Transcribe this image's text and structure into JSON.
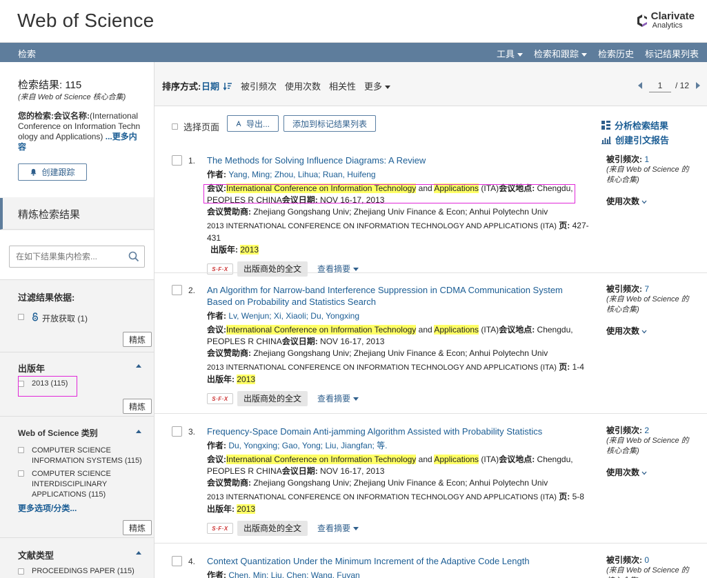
{
  "header": {
    "title": "Web of Science",
    "brand_name": "Clarivate",
    "brand_sub": "Analytics"
  },
  "nav": {
    "left": "检索",
    "items": [
      "工具",
      "检索和跟踪",
      "检索历史",
      "标记结果列表"
    ]
  },
  "sidebar": {
    "results_title": "检索结果: 115",
    "results_sub": "(来自 Web of Science 核心合集)",
    "query_label": "您的检索:",
    "query_field": "会议名称:",
    "query_value": "(International Conference on Information Technology and Applications)",
    "query_more": "...更多内容",
    "alert_button": "创建跟踪",
    "refine_title": "精炼检索结果",
    "search_placeholder": "在如下结果集内检索...",
    "filter_by": "过滤结果依据:",
    "open_access": "开放获取 (1)",
    "refine_btn": "精炼",
    "year_title": "出版年",
    "year_item": "2013 (115)",
    "category_title": "Web of Science 类别",
    "cat1": "COMPUTER SCIENCE INFORMATION SYSTEMS (115)",
    "cat2": "COMPUTER SCIENCE INTERDISCIPLINARY APPLICATIONS (115)",
    "more_options": "更多选项/分类...",
    "doctype_title": "文献类型",
    "doctype_item": "PROCEEDINGS PAPER (115)"
  },
  "sortbar": {
    "label": "排序方式:",
    "options": [
      "日期",
      "被引频次",
      "使用次数",
      "相关性",
      "更多"
    ]
  },
  "pager": {
    "current": "1",
    "total": "/ 12"
  },
  "actions": {
    "select_page": "选择页面",
    "export": "导出...",
    "add_marked": "添加到标记结果列表",
    "analyze": "分析检索结果",
    "citation_report": "创建引文报告"
  },
  "labels": {
    "author": "作者:",
    "conference": "会议:",
    "conf_and": "and",
    "conf_ita": "(ITA)",
    "conf_loc_label": "会议地点:",
    "conf_loc": "Chengdu, PEOPLES R CHINA",
    "conf_date_label": "会议日期:",
    "conf_date": "NOV 16-17, 2013",
    "sponsor_label": "会议赞助商:",
    "sponsor": "Zhejiang Gongshang Univ; Zhejiang Univ Finance & Econ; Anhui Polytechn Univ",
    "proceedings": "2013 INTERNATIONAL CONFERENCE ON INFORMATION TECHNOLOGY AND APPLICATIONS (ITA)",
    "pages_label": "页:",
    "year_label": "出版年:",
    "hl_conf": "International Conference on Information Technology",
    "hl_app": "Applications",
    "sfx": "S·F·X",
    "full_text": "出版商处的全文",
    "abstract": "查看摘要",
    "cited_label": "被引频次:",
    "cited_src": "(来自 Web of Science 的核心合集)",
    "usage": "使用次数"
  },
  "records": [
    {
      "num": "1.",
      "title": "The Methods for Solving Influence Diagrams: A Review",
      "authors": "Yang, Ming; Zhou, Lihua; Ruan, Huifeng",
      "pages": "427-431",
      "year": "2013",
      "cited": "1"
    },
    {
      "num": "2.",
      "title": "An Algorithm for Narrow-band Interference Suppression in CDMA Communication System Based on Probability and Statistics Search",
      "authors": "Lv, Wenjun; Xi, Xiaoli; Du, Yongxing",
      "pages": "1-4",
      "year": "2013",
      "cited": "7"
    },
    {
      "num": "3.",
      "title": "Frequency-Space Domain Anti-jamming Algorithm Assisted with Probability Statistics",
      "authors": "Du, Yongxing; Gao, Yong; Liu, Jiangfan; 等.",
      "pages": "5-8",
      "year": "2013",
      "cited": "2"
    },
    {
      "num": "4.",
      "title": "Context Quantization Under the Minimum Increment of the Adaptive Code Length",
      "authors": "Chen, Min; Liu, Chen; Wang, Fuyan",
      "cited": "0"
    }
  ]
}
